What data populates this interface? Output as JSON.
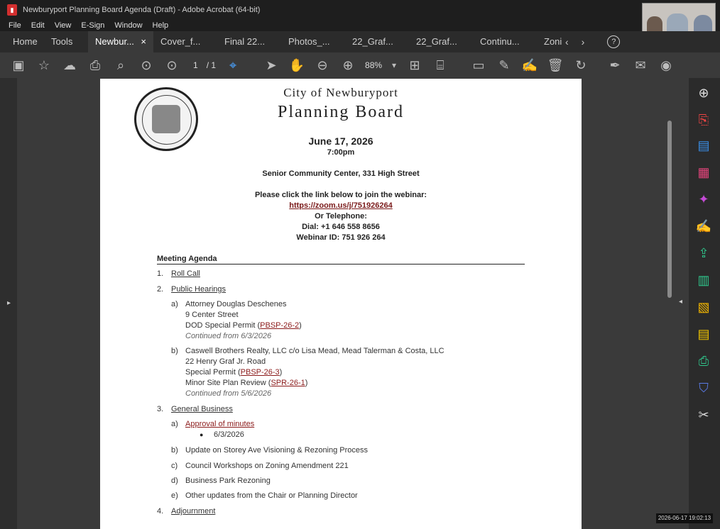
{
  "window": {
    "title": "Newburyport Planning Board Agenda (Draft) - Adobe Acrobat (64-bit)"
  },
  "menu": [
    "File",
    "Edit",
    "View",
    "E-Sign",
    "Window",
    "Help"
  ],
  "tabs": {
    "home": "Home",
    "tools": "Tools",
    "active": "Newbur...",
    "active_close": "×",
    "docs": [
      "Cover_f...",
      "Final 22...",
      "Photos_...",
      "22_Graf...",
      "22_Graf...",
      "Continu...",
      "Zoni"
    ]
  },
  "toolbar": {
    "page_current": "1",
    "page_total": "/ 1",
    "zoom": "88%"
  },
  "doc": {
    "city": "City of Newburyport",
    "board": "Planning Board",
    "date": "June 17, 2026",
    "time": "7:00pm",
    "location": "Senior Community Center, 331 High Street",
    "join_text": "Please click the link below to join the webinar:",
    "link": "https://zoom.us/j/751926264",
    "or_phone": "Or Telephone:",
    "dial": "Dial: +1 646 558 8656",
    "webinar_id": "Webinar ID: 751 926 264",
    "agenda_heading": "Meeting Agenda",
    "item1_num": "1.",
    "item1": "Roll Call",
    "item2_num": "2.",
    "item2": "Public Hearings",
    "h_a_num": "a)",
    "h_a_1": "Attorney Douglas Deschenes",
    "h_a_2": "9 Center Street",
    "h_a_3_pre": "DOD Special Permit (",
    "h_a_3_link": "PBSP-26-2",
    "h_a_3_post": ")",
    "h_a_4": "Continued from 6/3/2026",
    "h_b_num": "b)",
    "h_b_1": "Caswell Brothers Realty, LLC c/o Lisa Mead, Mead Talerman & Costa, LLC",
    "h_b_2": "22 Henry Graf Jr. Road",
    "h_b_3_pre": "Special Permit (",
    "h_b_3_link": "PBSP-26-3",
    "h_b_3_post": ")",
    "h_b_4_pre": "Minor Site Plan Review (",
    "h_b_4_link": "SPR-26-1",
    "h_b_4_post": ")",
    "h_b_5": "Continued from 5/6/2026",
    "item3_num": "3.",
    "item3": "General Business",
    "g_a_num": "a)",
    "g_a": "Approval of minutes",
    "g_a_bullet": "6/3/2026",
    "g_b_num": "b)",
    "g_b": "Update on Storey Ave Visioning & Rezoning Process",
    "g_c_num": "c)",
    "g_c": "Council Workshops on Zoning Amendment 221",
    "g_d_num": "d)",
    "g_d": "Business Park Rezoning",
    "g_e_num": "e)",
    "g_e": "Other updates from the Chair or Planning Director",
    "item4_num": "4.",
    "item4": "Adjournment"
  },
  "timestamp": "2026-06-17  19:02:13"
}
